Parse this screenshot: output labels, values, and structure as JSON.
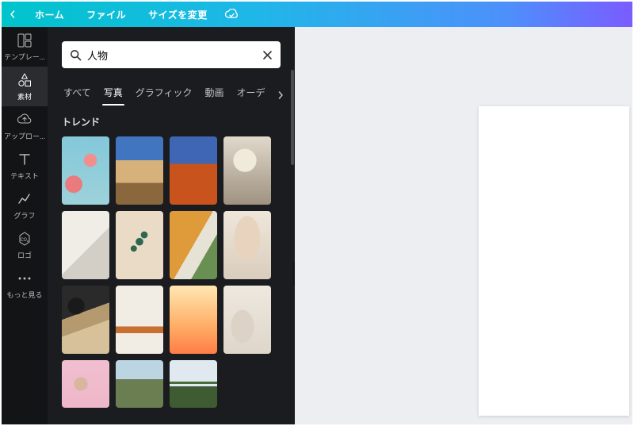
{
  "topbar": {
    "items": [
      "ホーム",
      "ファイル",
      "サイズを変更"
    ]
  },
  "sidebar": {
    "items": [
      {
        "icon": "templates",
        "label": "テンプレー..."
      },
      {
        "icon": "elements",
        "label": "素材"
      },
      {
        "icon": "upload",
        "label": "アップロー..."
      },
      {
        "icon": "text",
        "label": "テキスト"
      },
      {
        "icon": "chart",
        "label": "グラフ"
      },
      {
        "icon": "logo",
        "label": "ロゴ"
      },
      {
        "icon": "more",
        "label": "もっと見る"
      }
    ],
    "active_index": 1
  },
  "search": {
    "value": "人物",
    "placeholder": ""
  },
  "tabs": {
    "items": [
      "すべて",
      "写真",
      "グラフィック",
      "動画",
      "オーディオ"
    ],
    "truncated_last": "オーデ",
    "active_index": 1
  },
  "trending": {
    "title": "トレンド"
  }
}
